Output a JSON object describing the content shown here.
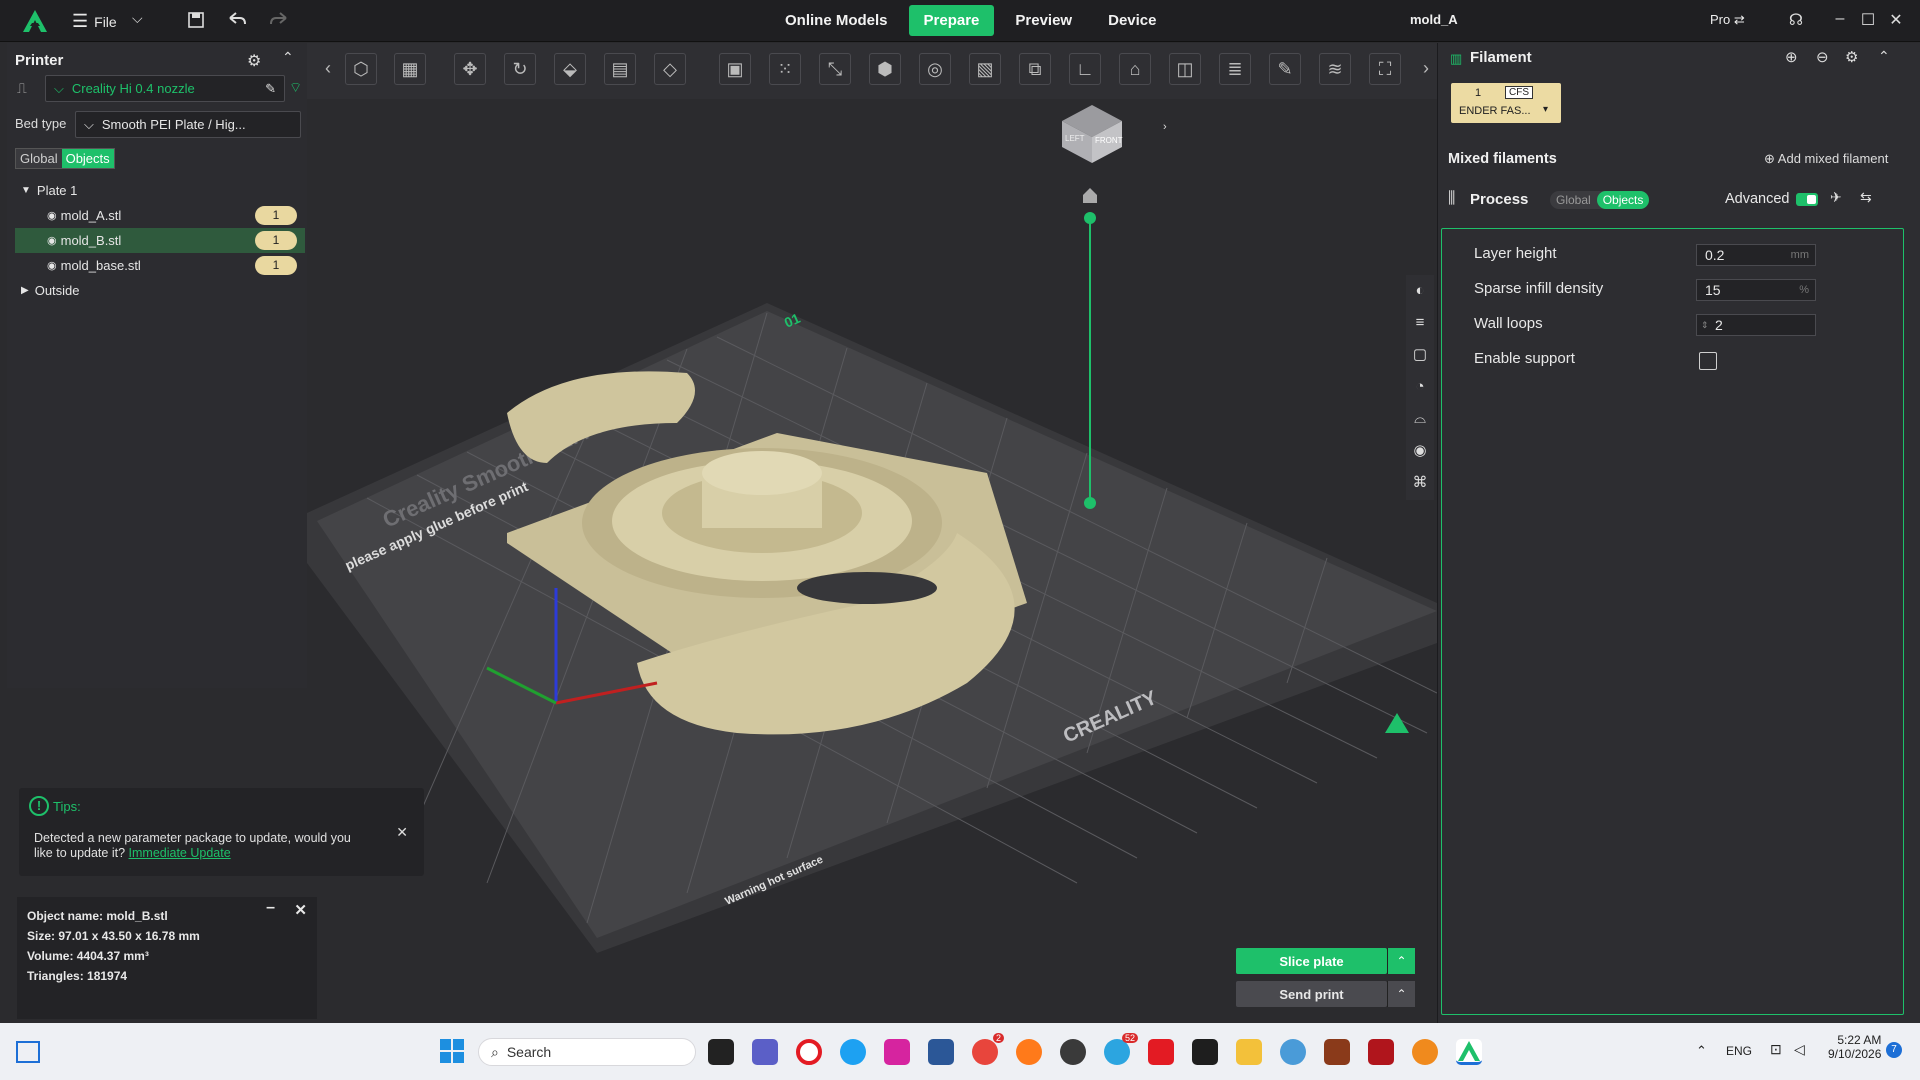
{
  "titlebar": {
    "file_label": "File",
    "nav": [
      "Online Models",
      "Prepare",
      "Preview",
      "Device"
    ],
    "active_nav": "Prepare",
    "document_title": "mold_A",
    "pro_label": "Pro"
  },
  "left_panel": {
    "printer_heading": "Printer",
    "printer_name": "Creality Hi 0.4 nozzle",
    "bed_type_label": "Bed type",
    "bed_type_value": "Smooth PEI Plate / Hig...",
    "scope_tabs": [
      "Global",
      "Objects"
    ],
    "plate_label": "Plate 1",
    "objects": [
      {
        "name": "mold_A.stl",
        "count": "1"
      },
      {
        "name": "mold_B.stl",
        "count": "1"
      },
      {
        "name": "mold_base.stl",
        "count": "1"
      }
    ],
    "outside_label": "Outside"
  },
  "viewport": {
    "view_cube_left": "LEFT",
    "view_cube_front": "FRONT",
    "plate_text_1": "please apply glue before print",
    "plate_text_2": "Creality Smooth PEI Plate",
    "plate_brand": "CREALITY",
    "plate_warning": "Warning hot surface",
    "plate_number": "01"
  },
  "tips": {
    "title": "Tips:",
    "message": "Detected a new parameter package to update, would you like to update it?",
    "link": "Immediate Update"
  },
  "object_info": {
    "name": "Object name: mold_B.stl",
    "size": "Size: 97.01 x 43.50 x 16.78 mm",
    "volume": "Volume: 4404.37 mm³",
    "triangles": "Triangles: 181974"
  },
  "right_panel": {
    "filament_heading": "Filament",
    "filament_slot": "1",
    "filament_cfs": "CFS",
    "filament_name": "ENDER FAS...",
    "mixed_heading": "Mixed filaments",
    "add_mixed": "Add mixed filament",
    "process_heading": "Process",
    "process_tabs": [
      "Global",
      "Objects"
    ],
    "advanced_label": "Advanced",
    "params": [
      {
        "label": "Layer height",
        "value": "0.2",
        "unit": "mm"
      },
      {
        "label": "Sparse infill density",
        "value": "15",
        "unit": "%"
      },
      {
        "label": "Wall loops",
        "value": "2",
        "unit": ""
      },
      {
        "label": "Enable support",
        "value": "",
        "unit": ""
      }
    ]
  },
  "actions": {
    "slice": "Slice plate",
    "send": "Send print"
  },
  "taskbar": {
    "search_placeholder": "Search",
    "lang": "ENG",
    "time": "5:22 AM",
    "date": "9/10/2026",
    "notif_count": "7",
    "chrome_badge": "2",
    "telegram_badge": "52"
  },
  "colors": {
    "accent": "#1ec06a",
    "model": "#d8cfa8",
    "bed": "#3a3a3c"
  }
}
